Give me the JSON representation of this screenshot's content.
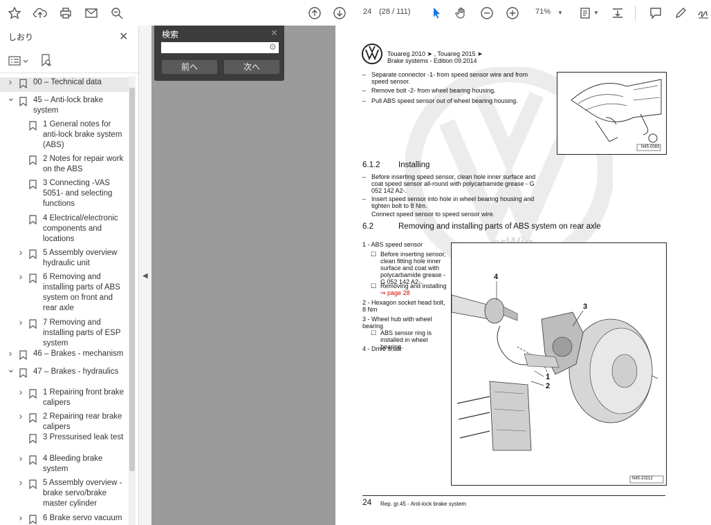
{
  "toolbar": {
    "page_number": "24",
    "page_of": "(28 / 111)",
    "zoom": "71%"
  },
  "sidebar": {
    "title": "しおり",
    "items": [
      {
        "label": "00 – Technical data",
        "level": 0,
        "chevron": "right",
        "selected": true
      },
      {
        "label": "45 – Anti-lock brake system",
        "level": 0,
        "chevron": "down"
      },
      {
        "label": "1 General notes for anti-lock brake system (ABS)",
        "level": 1,
        "chevron": ""
      },
      {
        "label": "2 Notes for repair work on the ABS",
        "level": 1,
        "chevron": ""
      },
      {
        "label": "3 Connecting -VAS 5051- and selecting functions",
        "level": 1,
        "chevron": ""
      },
      {
        "label": "4 Electrical/electronic components and locations",
        "level": 1,
        "chevron": ""
      },
      {
        "label": "5 Assembly overview hydraulic unit",
        "level": 1,
        "chevron": "right"
      },
      {
        "label": "6 Removing and installing parts of ABS system on front and rear axle",
        "level": 1,
        "chevron": "right"
      },
      {
        "label": "7 Removing and installing parts of ESP system",
        "level": 1,
        "chevron": "right"
      },
      {
        "label": "46 – Brakes - mechanism",
        "level": 0,
        "chevron": "right"
      },
      {
        "label": "47 – Brakes - hydraulics",
        "level": 0,
        "chevron": "down"
      },
      {
        "label": "1 Repairing front brake calipers",
        "level": 1,
        "chevron": "right"
      },
      {
        "label": "2 Repairing rear brake calipers",
        "level": 1,
        "chevron": "right"
      },
      {
        "label": "3 Pressurised leak test",
        "level": 1,
        "chevron": ""
      },
      {
        "label": "4 Bleeding brake system",
        "level": 1,
        "chevron": "right"
      },
      {
        "label": "5 Assembly overview - brake servo/brake master cylinder",
        "level": 1,
        "chevron": "right"
      },
      {
        "label": "6 Brake servo vacuum",
        "level": 1,
        "chevron": "right"
      }
    ]
  },
  "search": {
    "title": "検索",
    "prev": "前へ",
    "next": "次へ"
  },
  "doc": {
    "header_line1": "Touareg 2010 ➤ , Touareg 2015 ➤",
    "header_line2": "Brake systems - Edition 09.2014",
    "bullets_top": [
      "Separate connector -1- from speed sensor wire and from speed sensor.",
      "Remove bolt -2- from wheel bearing housing.",
      "Pull ABS speed sensor out of wheel bearing housing."
    ],
    "fig1_id": "N45-0083",
    "sec_612_num": "6.1.2",
    "sec_612_title": "Installing",
    "install_steps": [
      "Before inserting speed sensor, clean hole inner surface and coat speed sensor all-round with polycarbamide grease - G 052 142 A2-.",
      "Insert speed sensor into hole in wheel bearing housing and tighten bolt to 8 Nm.",
      "Connect speed sensor to speed sensor wire."
    ],
    "sec_62_num": "6.2",
    "sec_62_title": "Removing and installing parts of ABS system on rear axle",
    "parts": {
      "p1": "1 - ABS speed sensor",
      "p1_a": "Before inserting sensor, clean fitting hole inner surface and coat with polycarbamide grease - G 052 142 A2-.",
      "p1_b": "Removing and installing",
      "p1_b_link": "⇒ page 28",
      "p2": "2 - Hexagon socket head bolt, 8 Nm",
      "p3": "3 - Wheel hub with wheel bearing",
      "p3_a": "ABS sensor ring is installed in wheel bearing.",
      "p4": "4 - Drive shaft"
    },
    "fig2_id": "N45-10212",
    "footer_page": "24",
    "footer_text": "Rep. gr.45 - Anti-lock brake system",
    "callouts": [
      "4",
      "3",
      "1",
      "2"
    ],
    "watermark": "erWin"
  }
}
